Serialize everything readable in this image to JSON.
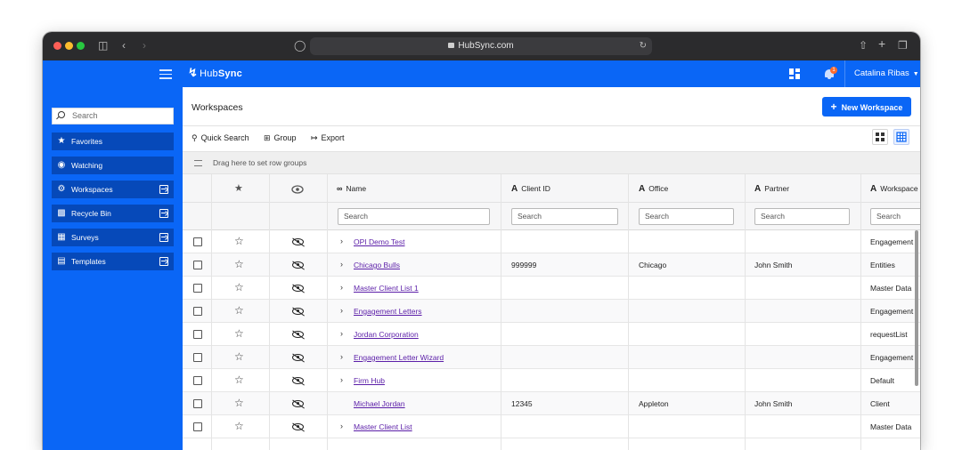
{
  "browser": {
    "url": "HubSync.com"
  },
  "app": {
    "logo_bold": "Hub",
    "logo_light": "Sync",
    "notification_count": "1",
    "user_name": "Catalina Ribas"
  },
  "sidebar": {
    "search_placeholder": "Search",
    "items": [
      {
        "label": "Favorites",
        "icon": "star-icon"
      },
      {
        "label": "Watching",
        "icon": "eye-icon"
      },
      {
        "label": "Workspaces",
        "icon": "gear-icon"
      },
      {
        "label": "Recycle Bin",
        "icon": "trash-icon"
      },
      {
        "label": "Surveys",
        "icon": "table-icon"
      },
      {
        "label": "Templates",
        "icon": "template-icon"
      }
    ]
  },
  "main": {
    "title": "Workspaces",
    "new_button": "New Workspace",
    "toolbar": {
      "quick_search": "Quick Search",
      "group": "Group",
      "export": "Export"
    },
    "drag_hint": "Drag here to set row groups"
  },
  "grid": {
    "columns": {
      "name": "Name",
      "client_id": "Client ID",
      "office": "Office",
      "partner": "Partner",
      "workspace": "Workspace"
    },
    "filter_placeholder": "Search",
    "rows": [
      {
        "name": "OPI Demo Test",
        "client_id": "",
        "office": "",
        "partner": "",
        "workspace": "Engagement",
        "expandable": true
      },
      {
        "name": "Chicago Bulls",
        "client_id": "999999",
        "office": "Chicago",
        "partner": "John Smith",
        "workspace": "Entities",
        "expandable": true
      },
      {
        "name": "Master Client List 1",
        "client_id": "",
        "office": "",
        "partner": "",
        "workspace": "Master Data",
        "expandable": true
      },
      {
        "name": "Engagement Letters",
        "client_id": "",
        "office": "",
        "partner": "",
        "workspace": "Engagement",
        "expandable": true
      },
      {
        "name": "Jordan Corporation",
        "client_id": "",
        "office": "",
        "partner": "",
        "workspace": "requestList",
        "expandable": true
      },
      {
        "name": "Engagement Letter Wizard",
        "client_id": "",
        "office": "",
        "partner": "",
        "workspace": "Engagement",
        "expandable": true
      },
      {
        "name": "Firm Hub",
        "client_id": "",
        "office": "",
        "partner": "",
        "workspace": "Default",
        "expandable": true
      },
      {
        "name": "Michael Jordan",
        "client_id": "12345",
        "office": "Appleton",
        "partner": "John Smith",
        "workspace": "Client",
        "expandable": false
      },
      {
        "name": "Master Client List",
        "client_id": "",
        "office": "",
        "partner": "",
        "workspace": "Master Data",
        "expandable": true
      }
    ]
  },
  "colors": {
    "brand": "#0a66f6",
    "sidebar_item": "#0649b9",
    "link": "#5b1ea8"
  }
}
